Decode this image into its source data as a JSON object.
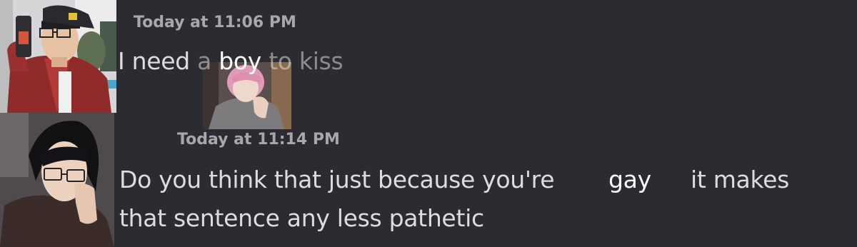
{
  "messages": [
    {
      "timestamp": "Today at 11:06 PM",
      "text_before": "I need ",
      "text_a": "a ",
      "text_boy": "boy",
      "text_after": " to kiss"
    },
    {
      "timestamp": "Today at 11:14 PM",
      "line1_start": "Do you think that just because you're",
      "line1_highlight": "gay",
      "line1_end": "it makes",
      "line2": "that sentence any less pathetic"
    }
  ],
  "colors": {
    "background": "#2c2b31",
    "timestamp": "#a7a7ad",
    "message_text": "#dddddf",
    "highlight_text": "#ffffff"
  },
  "icons": [
    "avatar-photo",
    "avatar-photo",
    "sticker-photo"
  ]
}
